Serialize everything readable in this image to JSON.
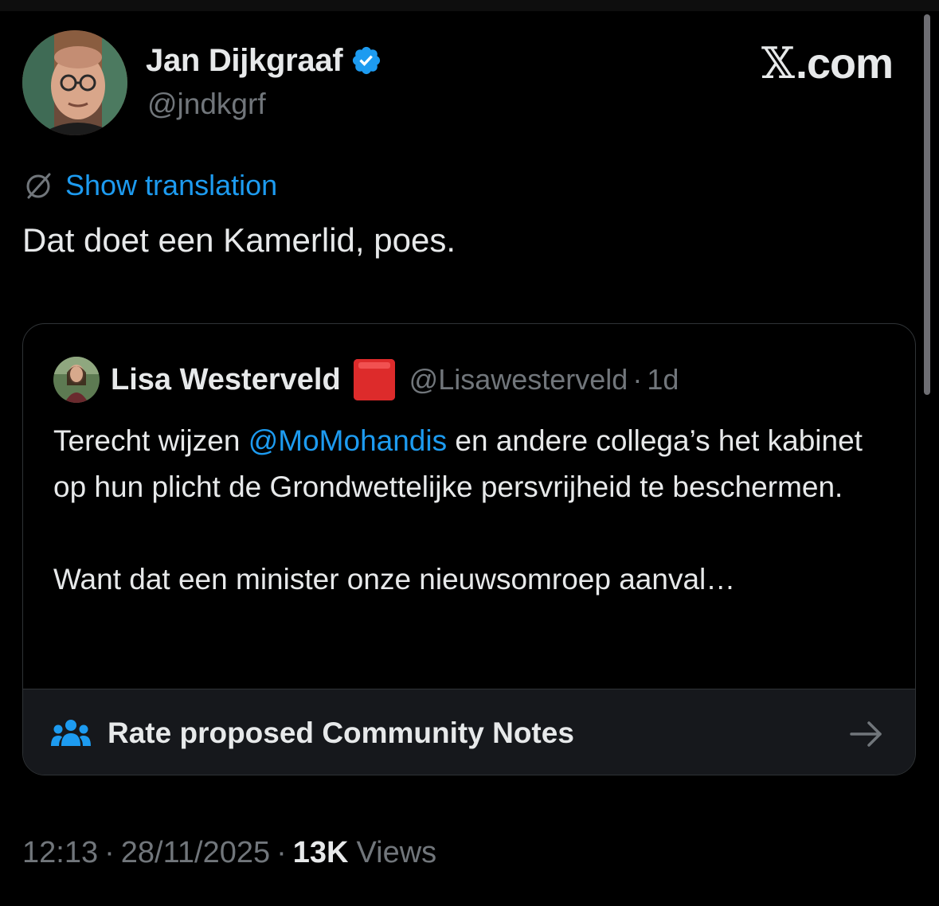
{
  "author": {
    "name": "Jan Dijkgraaf",
    "handle": "@jndkgrf",
    "verified": true
  },
  "brand": {
    "x": "𝕏",
    "suffix": ".com"
  },
  "translation": {
    "label": "Show translation",
    "icon": "globe-slash-icon"
  },
  "tweet": {
    "text": "Dat doet een Kamerlid, poes."
  },
  "quote": {
    "author_name": "Lisa Westerveld",
    "flag_icon": "red-square-icon",
    "handle": "@Lisawesterveld",
    "separator": "·",
    "time": "1d",
    "text_before_mention": "Terecht wijzen ",
    "mention": "@MoMohandis",
    "text_after_mention": " en andere collega’s het kabinet op hun plicht de Grondwettelijke persvrijheid te beschermen.",
    "text_second_paragraph": "Want dat een minister onze nieuwsomroep aanval…"
  },
  "community_notes": {
    "label": "Rate proposed Community Notes",
    "icon": "people-icon",
    "arrow_icon": "arrow-right-icon"
  },
  "meta": {
    "time": "12:13",
    "sep1": "·",
    "date": "28/11/2025",
    "sep2": "·",
    "views_count": "13K",
    "views_label": "Views"
  },
  "colors": {
    "background": "#000000",
    "text": "#e7e9ea",
    "secondary": "#71767b",
    "accent": "#1d9bf0",
    "border": "#2f3336",
    "flag": "#e0245e"
  }
}
